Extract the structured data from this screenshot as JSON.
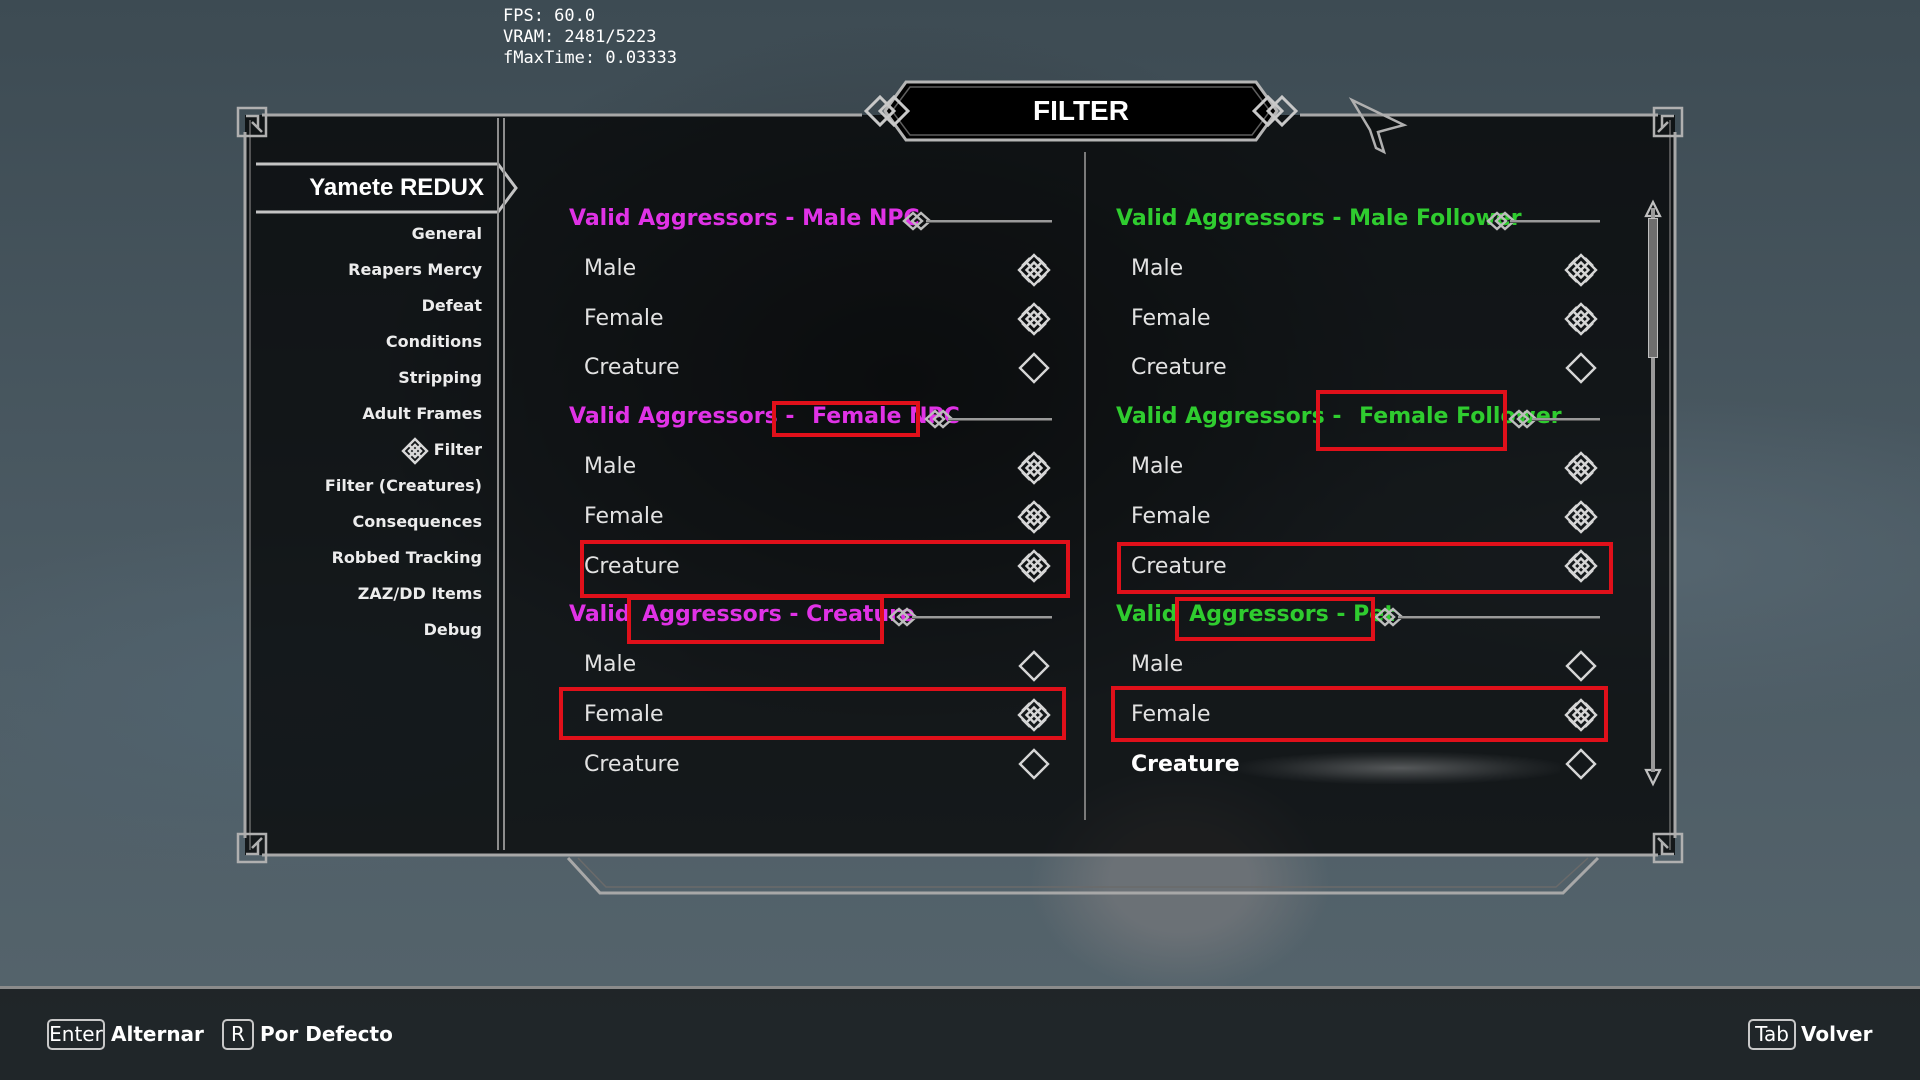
{
  "debug": {
    "fps": "FPS: 60.0",
    "vram": "VRAM: 2481/5223",
    "fmaxtime": "fMaxTime: 0.03333"
  },
  "window": {
    "title": "FILTER"
  },
  "sidebar": {
    "mod_title": "Yamete REDUX",
    "items": [
      {
        "label": "General"
      },
      {
        "label": "Reapers Mercy"
      },
      {
        "label": "Defeat"
      },
      {
        "label": "Conditions"
      },
      {
        "label": "Stripping"
      },
      {
        "label": "Adult Frames"
      },
      {
        "label": "Filter",
        "active": true
      },
      {
        "label": "Filter (Creatures)"
      },
      {
        "label": "Consequences"
      },
      {
        "label": "Robbed Tracking"
      },
      {
        "label": "ZAZ/DD Items"
      },
      {
        "label": "Debug"
      }
    ]
  },
  "left": {
    "sections": [
      {
        "header": "Valid Aggressors - Male NPC",
        "options": [
          {
            "label": "Male",
            "checked": true
          },
          {
            "label": "Female",
            "checked": true
          },
          {
            "label": "Creature",
            "checked": false
          }
        ]
      },
      {
        "header_pre": "Valid Aggressors - ",
        "header_hl": "Female NPC",
        "options": [
          {
            "label": "Male",
            "checked": true
          },
          {
            "label": "Female",
            "checked": true
          },
          {
            "label": "Creature",
            "checked": true
          }
        ]
      },
      {
        "header_pre": "Valid ",
        "header_hl": "Aggressors - Creature",
        "options": [
          {
            "label": "Male",
            "checked": false
          },
          {
            "label": "Female",
            "checked": true
          },
          {
            "label": "Creature",
            "checked": false
          }
        ]
      }
    ]
  },
  "right": {
    "sections": [
      {
        "header": "Valid Aggressors - Male Follower",
        "options": [
          {
            "label": "Male",
            "checked": true
          },
          {
            "label": "Female",
            "checked": true
          },
          {
            "label": "Creature",
            "checked": false
          }
        ]
      },
      {
        "header_pre": "Valid Aggressors - ",
        "header_hl": "Female Follower",
        "options": [
          {
            "label": "Male",
            "checked": true
          },
          {
            "label": "Female",
            "checked": true
          },
          {
            "label": "Creature",
            "checked": true
          }
        ]
      },
      {
        "header_pre": "Valid ",
        "header_hl": "Aggressors - Pet",
        "options": [
          {
            "label": "Male",
            "checked": false
          },
          {
            "label": "Female",
            "checked": true
          },
          {
            "label": "Creature",
            "checked": false
          }
        ]
      }
    ]
  },
  "footer": {
    "toggle": {
      "key": "Enter",
      "label": "Alternar"
    },
    "default": {
      "key": "R",
      "label": "Por Defecto"
    },
    "back": {
      "key": "Tab",
      "label": "Volver"
    }
  },
  "colors": {
    "npc_header": "#e032e6",
    "follower_header": "#2fcc2f",
    "highlight_box": "#e0101a"
  },
  "icons": {
    "checked": "knot-checked-icon",
    "unchecked": "diamond-unchecked-icon"
  }
}
